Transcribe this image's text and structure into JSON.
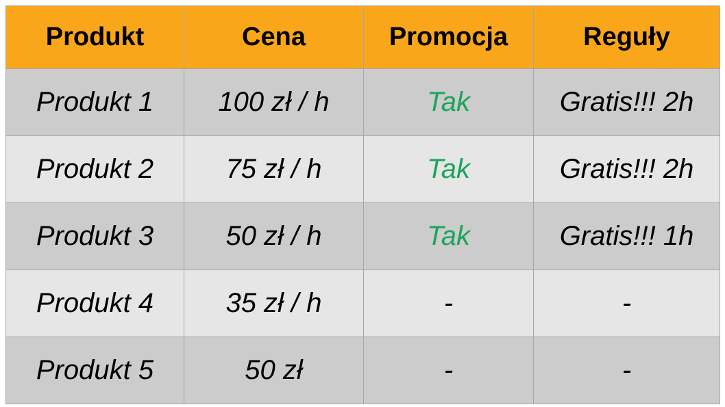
{
  "table": {
    "headers": [
      "Produkt",
      "Cena",
      "Promocja",
      "Reguły"
    ],
    "rows": [
      [
        "Produkt 1",
        "100 zł / h",
        "Tak",
        "Gratis!!! 2h"
      ],
      [
        "Produkt 2",
        "75 zł / h",
        "Tak",
        "Gratis!!! 2h"
      ],
      [
        "Produkt 3",
        "50 zł / h",
        "Tak",
        "Gratis!!! 1h"
      ],
      [
        "Produkt 4",
        "35 zł / h",
        "-",
        "-"
      ],
      [
        "Produkt 5",
        "50 zł",
        "-",
        "-"
      ]
    ],
    "colors": {
      "header_bg": "#faa61a",
      "row_odd_bg": "#cccccc",
      "row_even_bg": "#e6e6e6",
      "promo_yes": "#1aa55b"
    }
  }
}
